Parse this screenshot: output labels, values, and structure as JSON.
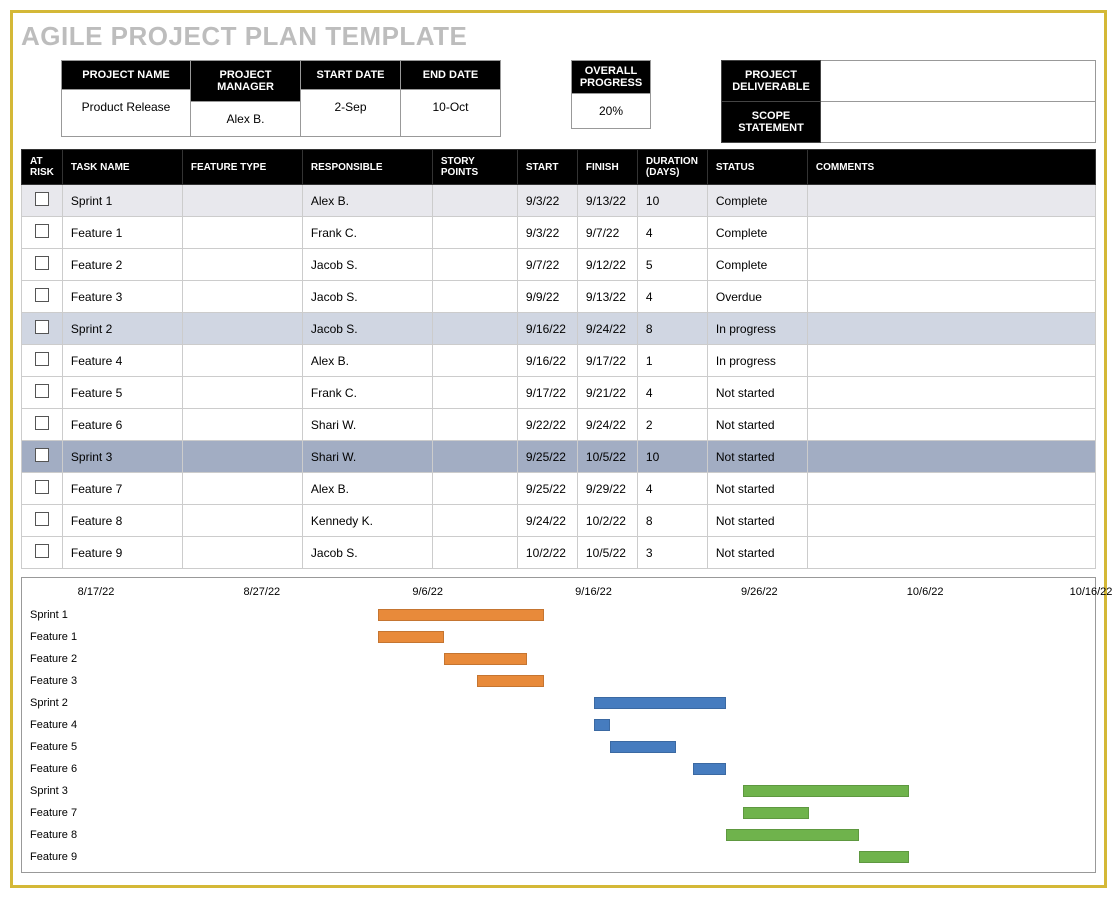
{
  "title": "AGILE PROJECT PLAN TEMPLATE",
  "info": {
    "headers": [
      "PROJECT NAME",
      "PROJECT MANAGER",
      "START DATE",
      "END DATE"
    ],
    "values": [
      "Product Release",
      "Alex B.",
      "2-Sep",
      "10-Oct"
    ],
    "overall_progress_label": "OVERALL PROGRESS",
    "overall_progress_value": "20%",
    "deliverable_label": "PROJECT DELIVERABLE",
    "deliverable_value": "",
    "scope_label": "SCOPE STATEMENT",
    "scope_value": ""
  },
  "table": {
    "headers": [
      "AT RISK",
      "TASK NAME",
      "FEATURE TYPE",
      "RESPONSIBLE",
      "STORY POINTS",
      "START",
      "FINISH",
      "DURATION (DAYS)",
      "STATUS",
      "COMMENTS"
    ],
    "rows": [
      {
        "cls": "sprint1",
        "task": "Sprint 1",
        "feat": "",
        "resp": "Alex B.",
        "pts": "",
        "start": "9/3/22",
        "finish": "9/13/22",
        "dur": "10",
        "status": "Complete",
        "comm": ""
      },
      {
        "cls": "",
        "task": "Feature 1",
        "feat": "",
        "resp": "Frank C.",
        "pts": "",
        "start": "9/3/22",
        "finish": "9/7/22",
        "dur": "4",
        "status": "Complete",
        "comm": ""
      },
      {
        "cls": "",
        "task": "Feature 2",
        "feat": "",
        "resp": "Jacob S.",
        "pts": "",
        "start": "9/7/22",
        "finish": "9/12/22",
        "dur": "5",
        "status": "Complete",
        "comm": ""
      },
      {
        "cls": "",
        "task": "Feature 3",
        "feat": "",
        "resp": "Jacob S.",
        "pts": "",
        "start": "9/9/22",
        "finish": "9/13/22",
        "dur": "4",
        "status": "Overdue",
        "comm": ""
      },
      {
        "cls": "sprint2",
        "task": "Sprint 2",
        "feat": "",
        "resp": "Jacob S.",
        "pts": "",
        "start": "9/16/22",
        "finish": "9/24/22",
        "dur": "8",
        "status": "In progress",
        "comm": ""
      },
      {
        "cls": "",
        "task": "Feature 4",
        "feat": "",
        "resp": "Alex B.",
        "pts": "",
        "start": "9/16/22",
        "finish": "9/17/22",
        "dur": "1",
        "status": "In progress",
        "comm": ""
      },
      {
        "cls": "",
        "task": "Feature 5",
        "feat": "",
        "resp": "Frank C.",
        "pts": "",
        "start": "9/17/22",
        "finish": "9/21/22",
        "dur": "4",
        "status": "Not started",
        "comm": ""
      },
      {
        "cls": "",
        "task": "Feature 6",
        "feat": "",
        "resp": "Shari W.",
        "pts": "",
        "start": "9/22/22",
        "finish": "9/24/22",
        "dur": "2",
        "status": "Not started",
        "comm": ""
      },
      {
        "cls": "sprint3",
        "task": "Sprint 3",
        "feat": "",
        "resp": "Shari W.",
        "pts": "",
        "start": "9/25/22",
        "finish": "10/5/22",
        "dur": "10",
        "status": "Not started",
        "comm": ""
      },
      {
        "cls": "",
        "task": "Feature 7",
        "feat": "",
        "resp": "Alex B.",
        "pts": "",
        "start": "9/25/22",
        "finish": "9/29/22",
        "dur": "4",
        "status": "Not started",
        "comm": ""
      },
      {
        "cls": "",
        "task": "Feature 8",
        "feat": "",
        "resp": "Kennedy K.",
        "pts": "",
        "start": "9/24/22",
        "finish": "10/2/22",
        "dur": "8",
        "status": "Not started",
        "comm": ""
      },
      {
        "cls": "",
        "task": "Feature 9",
        "feat": "",
        "resp": "Jacob S.",
        "pts": "",
        "start": "10/2/22",
        "finish": "10/5/22",
        "dur": "3",
        "status": "Not started",
        "comm": ""
      }
    ]
  },
  "chart_data": {
    "type": "bar",
    "title": "",
    "xlabel": "",
    "ylabel": "",
    "x_range": [
      "8/17/22",
      "10/16/22"
    ],
    "x_ticks": [
      "8/17/22",
      "8/27/22",
      "9/6/22",
      "9/16/22",
      "9/26/22",
      "10/6/22",
      "10/16/22"
    ],
    "series": [
      {
        "name": "Sprint 1",
        "start": "9/3/22",
        "end": "9/13/22",
        "color": "orange"
      },
      {
        "name": "Feature 1",
        "start": "9/3/22",
        "end": "9/7/22",
        "color": "orange"
      },
      {
        "name": "Feature 2",
        "start": "9/7/22",
        "end": "9/12/22",
        "color": "orange"
      },
      {
        "name": "Feature 3",
        "start": "9/9/22",
        "end": "9/13/22",
        "color": "orange"
      },
      {
        "name": "Sprint 2",
        "start": "9/16/22",
        "end": "9/24/22",
        "color": "blue"
      },
      {
        "name": "Feature 4",
        "start": "9/16/22",
        "end": "9/17/22",
        "color": "blue"
      },
      {
        "name": "Feature 5",
        "start": "9/17/22",
        "end": "9/21/22",
        "color": "blue"
      },
      {
        "name": "Feature 6",
        "start": "9/22/22",
        "end": "9/24/22",
        "color": "blue"
      },
      {
        "name": "Sprint 3",
        "start": "9/25/22",
        "end": "10/5/22",
        "color": "green"
      },
      {
        "name": "Feature 7",
        "start": "9/25/22",
        "end": "9/29/22",
        "color": "green"
      },
      {
        "name": "Feature 8",
        "start": "9/24/22",
        "end": "10/2/22",
        "color": "green"
      },
      {
        "name": "Feature 9",
        "start": "10/2/22",
        "end": "10/5/22",
        "color": "green"
      }
    ]
  }
}
